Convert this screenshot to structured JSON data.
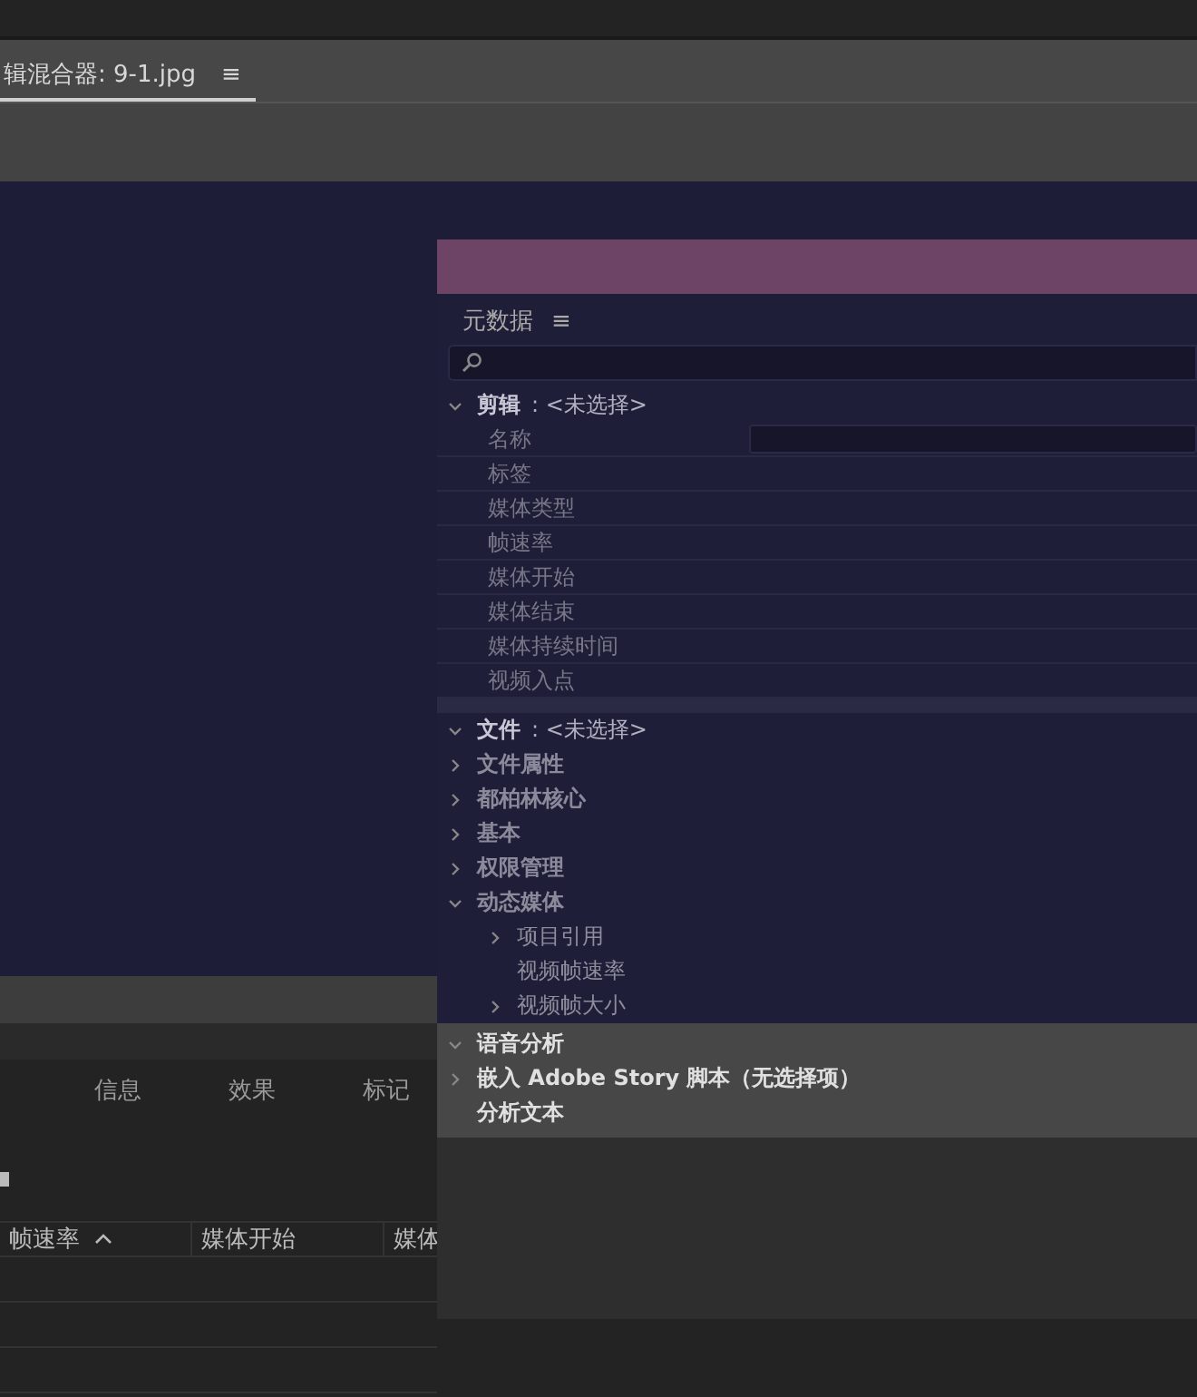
{
  "top_tab": {
    "label": "辑混合器: 9-1.jpg",
    "menu": "≡",
    "selected": true
  },
  "bottom_panel": {
    "tabs": [
      {
        "label": "信息",
        "selected": false
      },
      {
        "label": "效果",
        "selected": false
      },
      {
        "label": "标记",
        "selected": false
      }
    ],
    "columns": [
      {
        "label": "帧速率",
        "sorted": true
      },
      {
        "label": "媒体开始",
        "sorted": false
      },
      {
        "label": "媒体",
        "sorted": false
      }
    ]
  },
  "metadata_panel": {
    "title": "元数据",
    "menu": "≡",
    "clip_section": {
      "label": "剪辑",
      "value": ": <未选择>",
      "expanded": true,
      "rows": [
        {
          "label": "名称",
          "kind": "field"
        },
        {
          "label": "标签",
          "kind": "text"
        },
        {
          "label": "媒体类型",
          "kind": "text"
        },
        {
          "label": "帧速率",
          "kind": "text"
        },
        {
          "label": "媒体开始",
          "kind": "text"
        },
        {
          "label": "媒体结束",
          "kind": "text"
        },
        {
          "label": "媒体持续时间",
          "kind": "text"
        },
        {
          "label": "视频入点",
          "kind": "text"
        }
      ]
    },
    "file_section": {
      "label": "文件",
      "value": ": <未选择>",
      "expanded": true,
      "items": [
        {
          "kind": "group",
          "label": "文件属性",
          "expanded": false
        },
        {
          "kind": "group",
          "label": "都柏林核心",
          "expanded": false
        },
        {
          "kind": "group",
          "label": "基本",
          "expanded": false
        },
        {
          "kind": "group",
          "label": "权限管理",
          "expanded": false
        },
        {
          "kind": "group",
          "label": "动态媒体",
          "expanded": true,
          "children": [
            {
              "kind": "group",
              "label": "项目引用",
              "expanded": false
            },
            {
              "kind": "leaf",
              "label": "视频帧速率"
            },
            {
              "kind": "group",
              "label": "视频帧大小",
              "expanded": false
            }
          ]
        }
      ]
    },
    "speech_section": {
      "label": "语音分析",
      "expanded": true,
      "items": [
        {
          "kind": "group",
          "label": "嵌入 Adobe Story 脚本（无选择项）",
          "expanded": false
        },
        {
          "kind": "leaf",
          "label": "分析文本"
        }
      ]
    }
  }
}
